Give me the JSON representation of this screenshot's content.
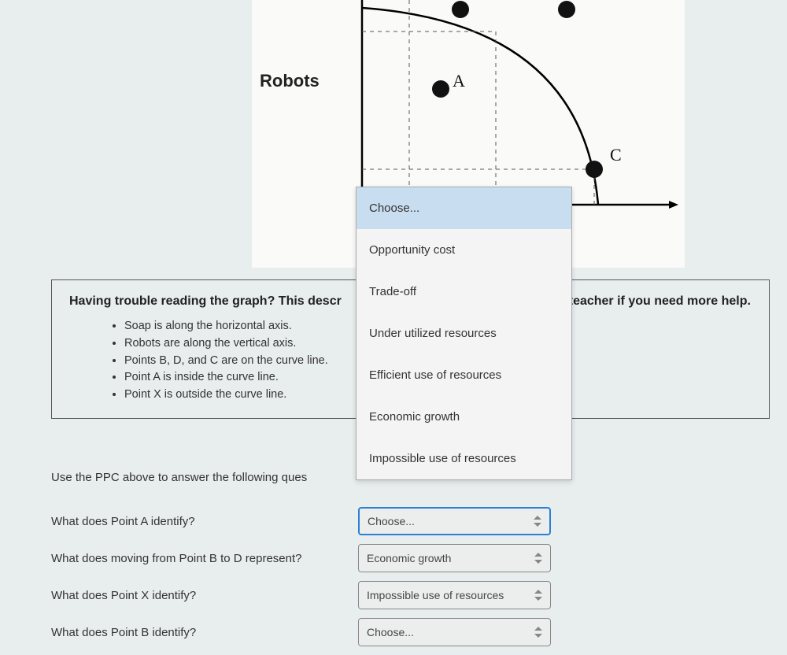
{
  "chart": {
    "y_axis_label": "Robots",
    "points": {
      "A": "A",
      "C": "C"
    }
  },
  "description": {
    "title_left": "Having trouble reading the graph? This descr",
    "title_right": "teacher if you need more help.",
    "items": [
      "Soap is along the horizontal axis.",
      "Robots are along the vertical axis.",
      "Points B, D, and C are on the curve line.",
      "Point A is inside the curve line.",
      "Point X is outside the curve line."
    ]
  },
  "instructions": "Use the PPC above to answer the following ques",
  "dropdown": {
    "options": [
      "Choose...",
      "Opportunity cost",
      "Trade-off",
      "Under utilized resources",
      "Efficient use of resources",
      "Economic growth",
      "Impossible use of resources"
    ]
  },
  "questions": [
    {
      "text": "What does Point A identify?",
      "value": "Choose...",
      "active": true
    },
    {
      "text": "What does moving from Point B to D represent?",
      "value": "Economic growth",
      "active": false
    },
    {
      "text": "What does Point X identify?",
      "value": "Impossible use of resources",
      "active": false
    },
    {
      "text": "What does Point B identify?",
      "value": "Choose...",
      "active": false
    }
  ]
}
